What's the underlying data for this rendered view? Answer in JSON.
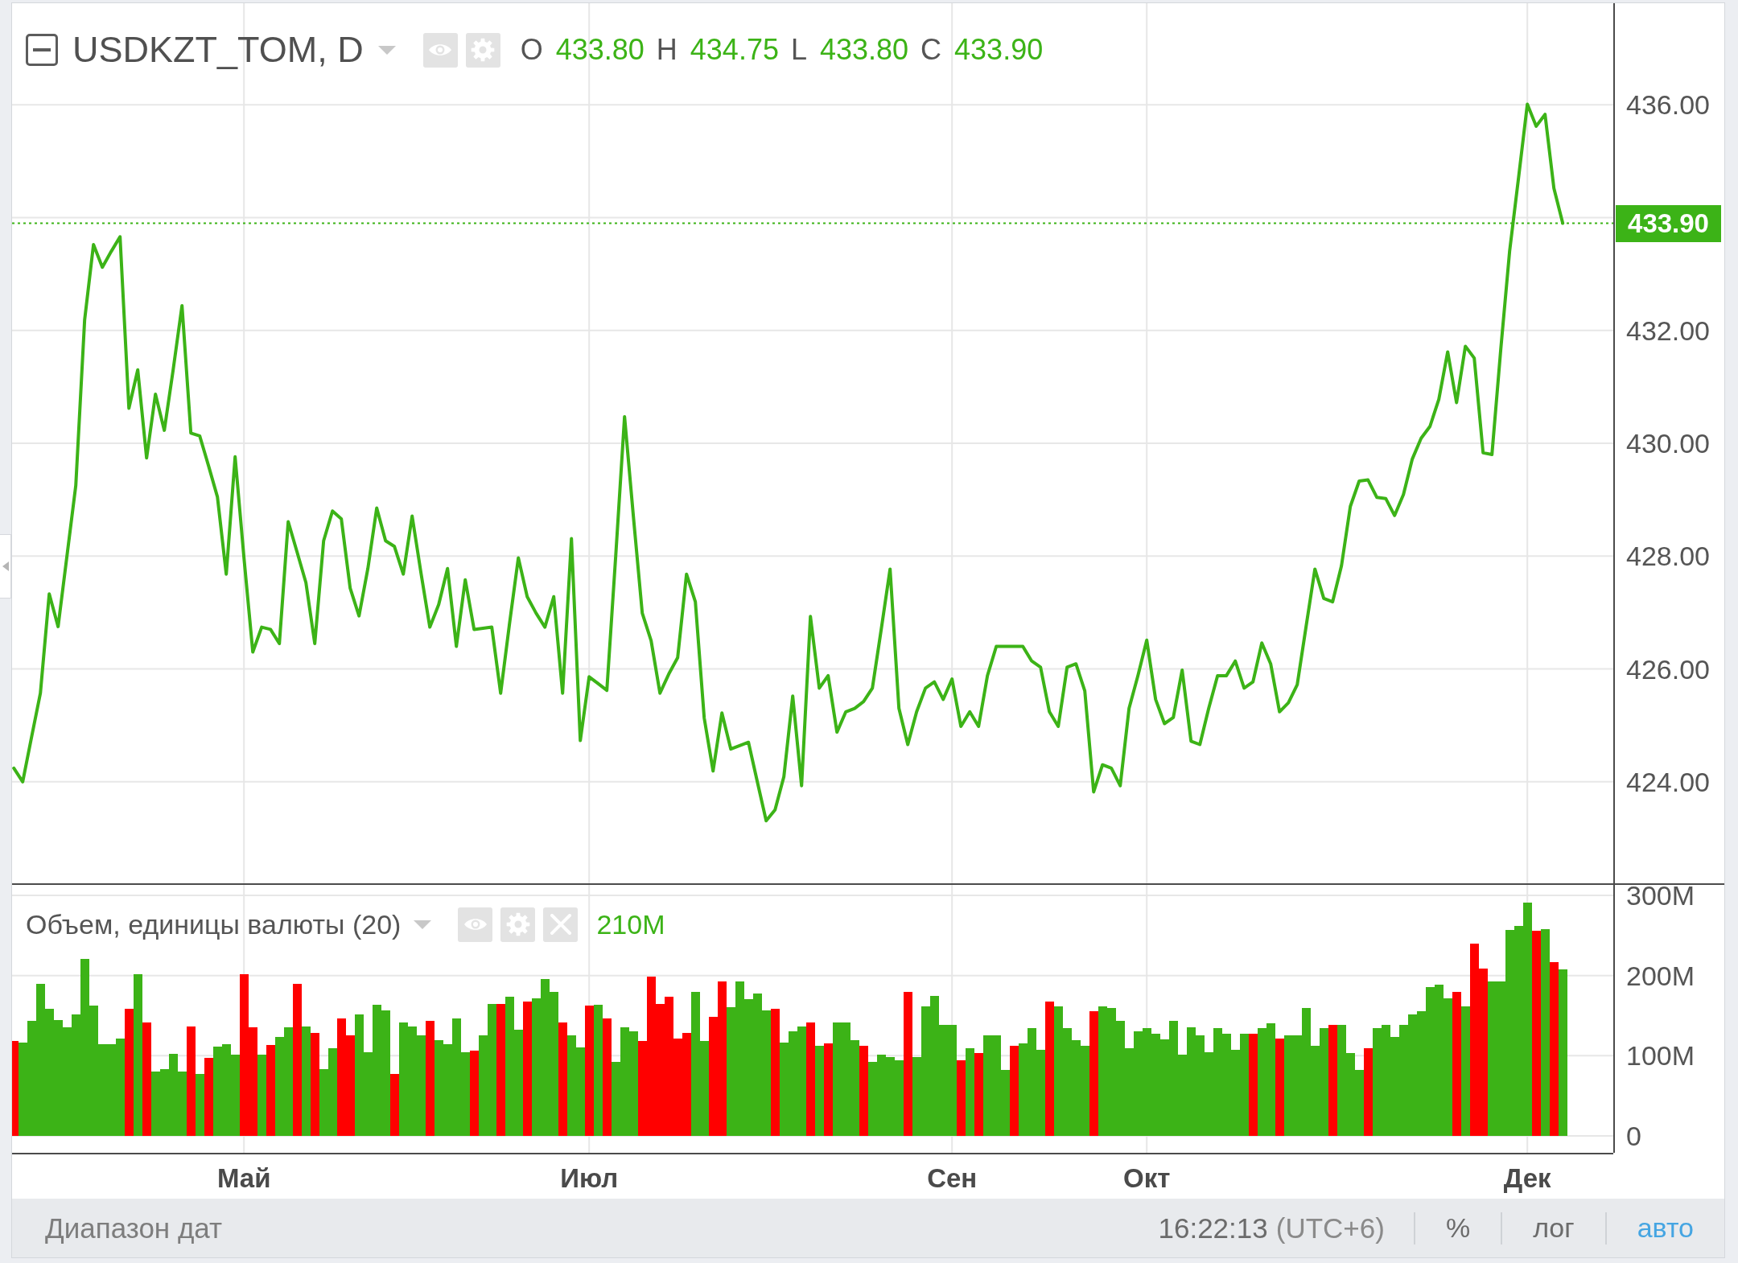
{
  "symbol_legend": {
    "title": "USDKZT_TOM, D",
    "ohlc": [
      {
        "key": "O",
        "value": "433.80"
      },
      {
        "key": "H",
        "value": "434.75"
      },
      {
        "key": "L",
        "value": "433.80"
      },
      {
        "key": "C",
        "value": "433.90"
      }
    ]
  },
  "price_pane": {
    "chart_data": {
      "type": "line",
      "grid": true,
      "series": [
        {
          "color": "#3cb317",
          "values": [
            424.24,
            424.0,
            424.79,
            425.57,
            427.33,
            426.75,
            428.0,
            429.25,
            432.19,
            433.52,
            433.12,
            433.4,
            433.66,
            430.62,
            431.3,
            429.74,
            430.87,
            430.23,
            431.3,
            432.44,
            430.18,
            430.13,
            429.6,
            429.05,
            427.68,
            429.76,
            427.97,
            426.3,
            426.74,
            426.7,
            426.45,
            428.61,
            428.07,
            427.53,
            426.45,
            428.27,
            428.8,
            428.66,
            427.43,
            426.94,
            427.78,
            428.85,
            428.27,
            428.17,
            427.68,
            428.71,
            427.7,
            426.74,
            427.14,
            427.78,
            426.4,
            427.58,
            426.7,
            426.72,
            426.74,
            425.57,
            426.8,
            427.97,
            427.28,
            426.99,
            426.74,
            427.28,
            425.57,
            428.31,
            424.73,
            425.86,
            425.74,
            425.62,
            428.0,
            430.47,
            428.7,
            426.99,
            426.5,
            425.57,
            425.91,
            426.2,
            427.68,
            427.19,
            425.13,
            424.19,
            425.22,
            424.58,
            424.64,
            424.7,
            424.0,
            423.31,
            423.5,
            424.09,
            425.52,
            423.93,
            426.93,
            425.66,
            425.88,
            424.88,
            425.24,
            425.3,
            425.42,
            425.66,
            426.7,
            427.77,
            425.3,
            424.66,
            425.24,
            425.66,
            425.77,
            425.46,
            425.82,
            424.98,
            425.24,
            424.98,
            425.88,
            426.4,
            426.4,
            426.4,
            426.4,
            426.14,
            426.03,
            425.24,
            424.98,
            426.03,
            426.09,
            425.61,
            423.82,
            424.3,
            424.24,
            423.93,
            425.3,
            425.88,
            426.51,
            425.46,
            425.03,
            425.14,
            425.98,
            424.72,
            424.66,
            425.3,
            425.88,
            425.88,
            426.14,
            425.66,
            425.77,
            426.46,
            426.09,
            425.24,
            425.4,
            425.72,
            426.75,
            427.77,
            427.25,
            427.19,
            427.83,
            428.88,
            429.33,
            429.35,
            429.04,
            429.02,
            428.72,
            429.09,
            429.72,
            430.09,
            430.3,
            430.78,
            431.62,
            430.72,
            431.72,
            431.51,
            429.83,
            429.8,
            431.67,
            433.41,
            434.7,
            436.01,
            435.62,
            435.83,
            434.52,
            433.9
          ]
        }
      ],
      "ylim": [
        422.2,
        437.8
      ],
      "yticks": [
        {
          "value": 424,
          "label": "424.00"
        },
        {
          "value": 426,
          "label": "426.00"
        },
        {
          "value": 428,
          "label": "428.00"
        },
        {
          "value": 430,
          "label": "430.00"
        },
        {
          "value": 432,
          "label": "432.00"
        },
        {
          "value": 436,
          "label": "436.00"
        }
      ],
      "ref_lines": [
        {
          "axis": "y",
          "value": 433.9,
          "label": "433.90"
        }
      ]
    }
  },
  "volume_pane": {
    "legend": {
      "title": "Объем, единицы валюты (20)",
      "value": "210M"
    },
    "chart_data": {
      "type": "bar",
      "grid": true,
      "categories": [
        null,
        null,
        null,
        null,
        null,
        null,
        null,
        null,
        null,
        null,
        null,
        null,
        null,
        null,
        null,
        null,
        null,
        null,
        null,
        null,
        null,
        null,
        null,
        null,
        null,
        null,
        "Май",
        null,
        null,
        null,
        null,
        null,
        null,
        null,
        null,
        null,
        null,
        null,
        null,
        null,
        null,
        null,
        null,
        null,
        null,
        null,
        null,
        null,
        null,
        null,
        null,
        null,
        null,
        null,
        null,
        null,
        null,
        null,
        null,
        null,
        null,
        null,
        null,
        null,
        null,
        "Июл",
        null,
        null,
        null,
        null,
        null,
        null,
        null,
        null,
        null,
        null,
        null,
        null,
        null,
        null,
        null,
        null,
        null,
        null,
        null,
        null,
        null,
        null,
        null,
        null,
        null,
        null,
        null,
        null,
        null,
        null,
        null,
        null,
        null,
        null,
        null,
        null,
        null,
        null,
        null,
        null,
        "Сен",
        null,
        null,
        null,
        null,
        null,
        null,
        null,
        null,
        null,
        null,
        null,
        null,
        null,
        null,
        null,
        null,
        null,
        null,
        null,
        null,
        null,
        "Окт",
        null,
        null,
        null,
        null,
        null,
        null,
        null,
        null,
        null,
        null,
        null,
        null,
        null,
        null,
        null,
        null,
        null,
        null,
        null,
        null,
        null,
        null,
        null,
        null,
        null,
        null,
        null,
        null,
        null,
        null,
        null,
        null,
        null,
        null,
        null,
        null,
        null,
        null,
        null,
        null,
        null,
        null,
        "Дек",
        null,
        null,
        null,
        null
      ],
      "series": [
        {
          "color": "#3cb317",
          "values": [
            null,
            116,
            143,
            190,
            159,
            145,
            135,
            152,
            221,
            163,
            114,
            114,
            121,
            null,
            202,
            null,
            80,
            83,
            102,
            80,
            null,
            77,
            null,
            111,
            114,
            101,
            null,
            null,
            101,
            null,
            123,
            135,
            null,
            136,
            null,
            83,
            109,
            null,
            null,
            152,
            104,
            164,
            157,
            null,
            141,
            136,
            125,
            null,
            119,
            114,
            147,
            104,
            null,
            125,
            165,
            null,
            174,
            132,
            null,
            172,
            196,
            180,
            null,
            125,
            110,
            null,
            164,
            null,
            92,
            135,
            130,
            null,
            null,
            null,
            null,
            null,
            null,
            180,
            118,
            null,
            null,
            161,
            193,
            171,
            178,
            157,
            null,
            116,
            130,
            136,
            null,
            112,
            null,
            141,
            141,
            119,
            null,
            92,
            101,
            98,
            94,
            null,
            98,
            162,
            175,
            138,
            138,
            null,
            109,
            null,
            125,
            125,
            82,
            null,
            115,
            134,
            107,
            null,
            162,
            134,
            119,
            112,
            null,
            162,
            160,
            143,
            109,
            130,
            134,
            127,
            120,
            143,
            101,
            135,
            125,
            104,
            134,
            127,
            107,
            127,
            null,
            134,
            140,
            null,
            125,
            125,
            160,
            112,
            134,
            null,
            138,
            103,
            82,
            null,
            134,
            138,
            123,
            138,
            152,
            156,
            186,
            189,
            172,
            null,
            162,
            null,
            null,
            193,
            193,
            257,
            262,
            291,
            null,
            258,
            null,
            208
          ]
        },
        {
          "color": "#ff0000",
          "values": [
            118,
            null,
            null,
            null,
            null,
            null,
            null,
            null,
            null,
            null,
            null,
            null,
            null,
            159,
            null,
            141,
            null,
            null,
            null,
            null,
            136,
            null,
            97,
            null,
            null,
            null,
            202,
            135,
            null,
            113,
            null,
            null,
            190,
            null,
            128,
            null,
            null,
            147,
            125,
            null,
            null,
            null,
            null,
            77,
            null,
            null,
            null,
            143,
            null,
            null,
            null,
            null,
            106,
            null,
            null,
            165,
            null,
            null,
            168,
            null,
            null,
            null,
            141,
            null,
            null,
            163,
            null,
            147,
            null,
            null,
            null,
            118,
            199,
            165,
            174,
            121,
            128,
            null,
            null,
            149,
            193,
            null,
            null,
            null,
            null,
            null,
            159,
            null,
            null,
            null,
            141,
            null,
            115,
            null,
            null,
            null,
            112,
            null,
            null,
            null,
            null,
            180,
            null,
            null,
            null,
            null,
            null,
            94,
            null,
            103,
            null,
            null,
            null,
            112,
            null,
            null,
            null,
            168,
            null,
            null,
            null,
            null,
            156,
            null,
            null,
            null,
            null,
            null,
            null,
            null,
            null,
            null,
            null,
            null,
            null,
            null,
            null,
            null,
            null,
            null,
            127,
            null,
            null,
            121,
            null,
            null,
            null,
            null,
            null,
            138,
            null,
            null,
            null,
            109,
            null,
            null,
            null,
            null,
            null,
            null,
            null,
            null,
            null,
            180,
            null,
            240,
            209,
            null,
            null,
            null,
            null,
            null,
            256,
            null,
            217,
            null
          ]
        }
      ],
      "ylim": [
        -21,
        313
      ],
      "yticks": [
        0,
        {
          "value": 100,
          "label": "100M"
        },
        {
          "value": 200,
          "label": "200M"
        },
        {
          "value": 300,
          "label": "300M"
        }
      ]
    }
  },
  "status_bar": {
    "date_range": "Диапазон дат",
    "time": "16:22:13",
    "timezone": "(UTC+6)",
    "scale_buttons": [
      {
        "label": "%",
        "selected": false
      },
      {
        "label": "лог",
        "selected": false
      },
      {
        "label": "авто",
        "selected": true
      }
    ]
  }
}
